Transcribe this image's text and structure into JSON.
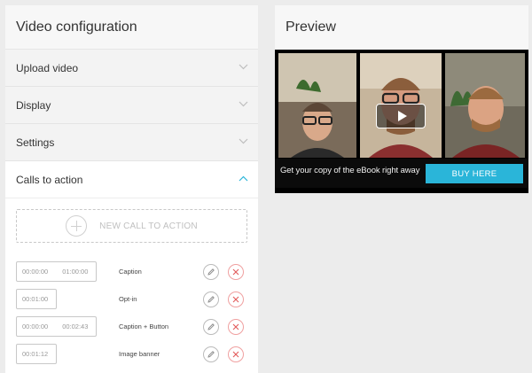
{
  "config": {
    "title": "Video configuration",
    "sections": [
      {
        "label": "Upload video",
        "state": "collapsed"
      },
      {
        "label": "Display",
        "state": "collapsed"
      },
      {
        "label": "Settings",
        "state": "collapsed"
      },
      {
        "label": "Calls to action",
        "state": "expanded"
      }
    ],
    "new_cta_label": "NEW CALL TO ACTION",
    "cta_items": [
      {
        "start": "00:00:00",
        "end": "01:00:00",
        "type": "Caption"
      },
      {
        "start": "00:01:00",
        "end": "",
        "type": "Opt-in"
      },
      {
        "start": "00:00:00",
        "end": "00:02:43",
        "type": "Caption + Button"
      },
      {
        "start": "00:01:12",
        "end": "",
        "type": "Image banner"
      }
    ]
  },
  "preview": {
    "title": "Preview",
    "cta_text": "Get your copy of the eBook right away",
    "button_label": "BUY HERE"
  },
  "colors": {
    "accent": "#2ab5d9",
    "delete": "#e25b5b",
    "panel_bg": "#f7f7f7",
    "page_bg": "#ececec"
  },
  "icons": {
    "collapsed": "chevron-down-icon",
    "expanded": "chevron-up-icon",
    "add": "plus-circle-icon",
    "edit": "pencil-icon",
    "delete": "close-icon",
    "play": "play-icon"
  }
}
